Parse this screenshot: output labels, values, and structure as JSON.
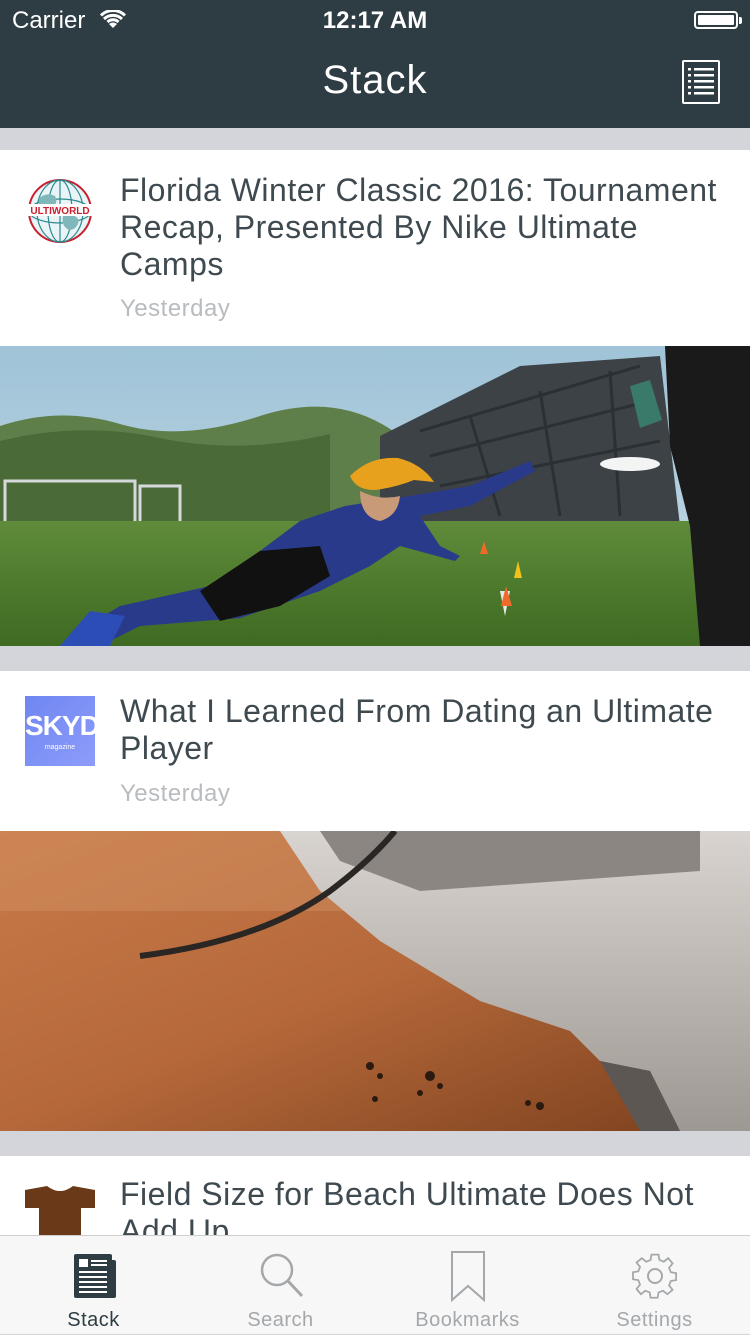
{
  "status_bar": {
    "carrier": "Carrier",
    "time": "12:17 AM"
  },
  "nav": {
    "title": "Stack",
    "list_icon": "list-icon"
  },
  "feed": [
    {
      "source_icon": "ultiworld-logo",
      "source_logo_text": "ULTIWORLD",
      "title": "Florida Winter Classic 2016: Tournament Recap, Presented By Nike Ultimate Camps",
      "time": "Yesterday",
      "image": "photo-ultimate-player-diving-for-disc"
    },
    {
      "source_icon": "skyd-logo",
      "source_logo_text": "SKYD",
      "source_logo_subtext": "magazine",
      "title": "What I Learned From Dating an Ultimate Player",
      "time": "Yesterday",
      "image": "photo-cleat-on-wooden-floor"
    },
    {
      "source_icon": "jersey-icon",
      "title": "Field Size for Beach Ultimate Does Not Add Up"
    }
  ],
  "tabs": [
    {
      "label": "Stack",
      "icon": "newspaper-icon",
      "active": true
    },
    {
      "label": "Search",
      "icon": "search-icon"
    },
    {
      "label": "Bookmarks",
      "icon": "bookmark-icon"
    },
    {
      "label": "Settings",
      "icon": "gear-icon"
    }
  ],
  "colors": {
    "nav_bg": "#2e3c43",
    "separator": "#d3d5da",
    "title_text": "#3f4a50",
    "time_text": "#b9bcbf"
  }
}
